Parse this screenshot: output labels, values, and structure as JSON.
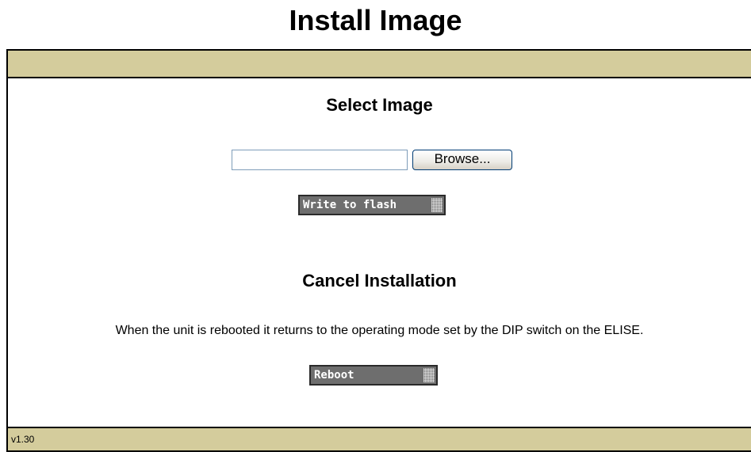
{
  "page": {
    "title": "Install Image"
  },
  "select_section": {
    "title": "Select Image",
    "file_input_value": "",
    "browse_label": "Browse...",
    "write_label": "Write to flash"
  },
  "cancel_section": {
    "title": "Cancel Installation",
    "description": "When the unit is rebooted it returns to the operating mode set by the DIP switch on the ELISE.",
    "reboot_label": "Reboot"
  },
  "footer": {
    "version": "v1.30"
  },
  "colors": {
    "bar_background": "#d4cc9c",
    "button_dark": "#6e6e6e"
  },
  "icons": {
    "button_grip": "grip-texture-icon"
  }
}
